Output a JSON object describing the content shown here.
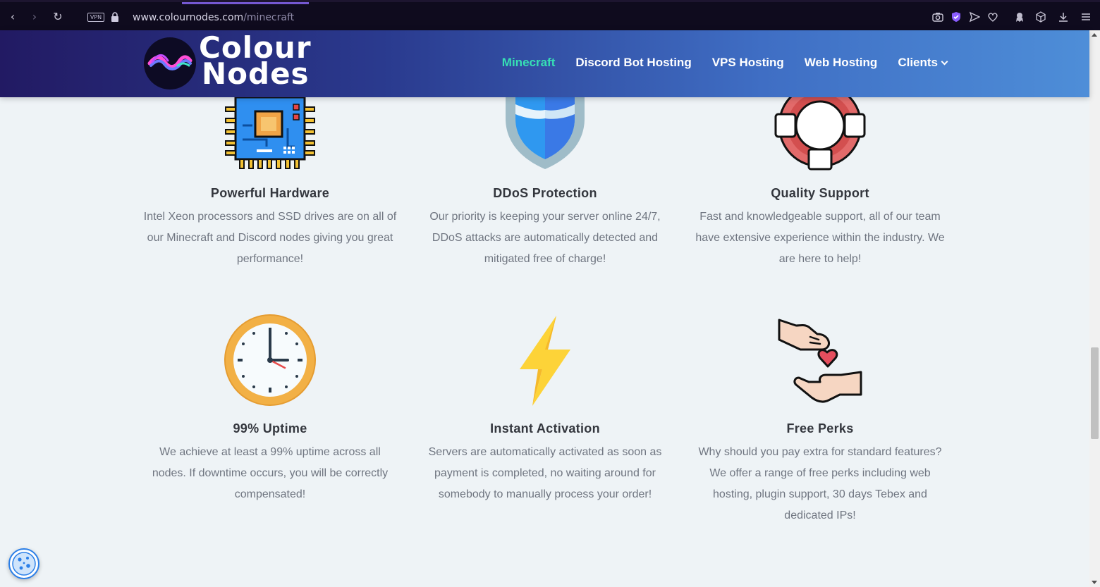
{
  "browser": {
    "url_host": "www.colournodes.com",
    "url_path": "/minecraft",
    "vpn_label": "VPN"
  },
  "header": {
    "logo_line1": "Colour",
    "logo_line2": "Nodes",
    "nav": [
      {
        "label": "Minecraft",
        "active": true
      },
      {
        "label": "Discord Bot Hosting"
      },
      {
        "label": "VPS Hosting"
      },
      {
        "label": "Web Hosting"
      },
      {
        "label": "Clients"
      }
    ]
  },
  "features": [
    {
      "title": "Powerful Hardware",
      "icon": "cpu-icon",
      "lines": [
        "Intel Xeon processors and SSD drives are on all of",
        "our Minecraft and Discord nodes giving you great",
        "performance!"
      ]
    },
    {
      "title": "DDoS Protection",
      "icon": "shield-icon",
      "lines": [
        "Our priority is keeping your server online 24/7,",
        "DDoS attacks are automatically detected and",
        "mitigated free of charge!"
      ]
    },
    {
      "title": "Quality Support",
      "icon": "lifebuoy-icon",
      "lines": [
        "Fast and knowledgeable support, all of our team",
        "have extensive experience within the industry. We",
        "are here to help!"
      ]
    },
    {
      "title": "99% Uptime",
      "icon": "clock-icon",
      "lines": [
        "We achieve at least a 99% uptime across all",
        "nodes. If downtime occurs, you will be correctly",
        "compensated!"
      ]
    },
    {
      "title": "Instant Activation",
      "icon": "lightning-icon",
      "lines": [
        "Servers are automatically activated as soon as",
        "payment is completed, no waiting around for",
        "somebody to manually process your order!"
      ]
    },
    {
      "title": "Free Perks",
      "icon": "giving-heart-icon",
      "lines": [
        "Why should you pay extra for standard features?",
        "We offer a range of free perks including web",
        "hosting, plugin support, 30 days Tebex and",
        "dedicated IPs!"
      ]
    }
  ],
  "colors": {
    "accent_nav": "#36e0b4",
    "header_start": "#221a63",
    "header_end": "#4e8ed8"
  }
}
